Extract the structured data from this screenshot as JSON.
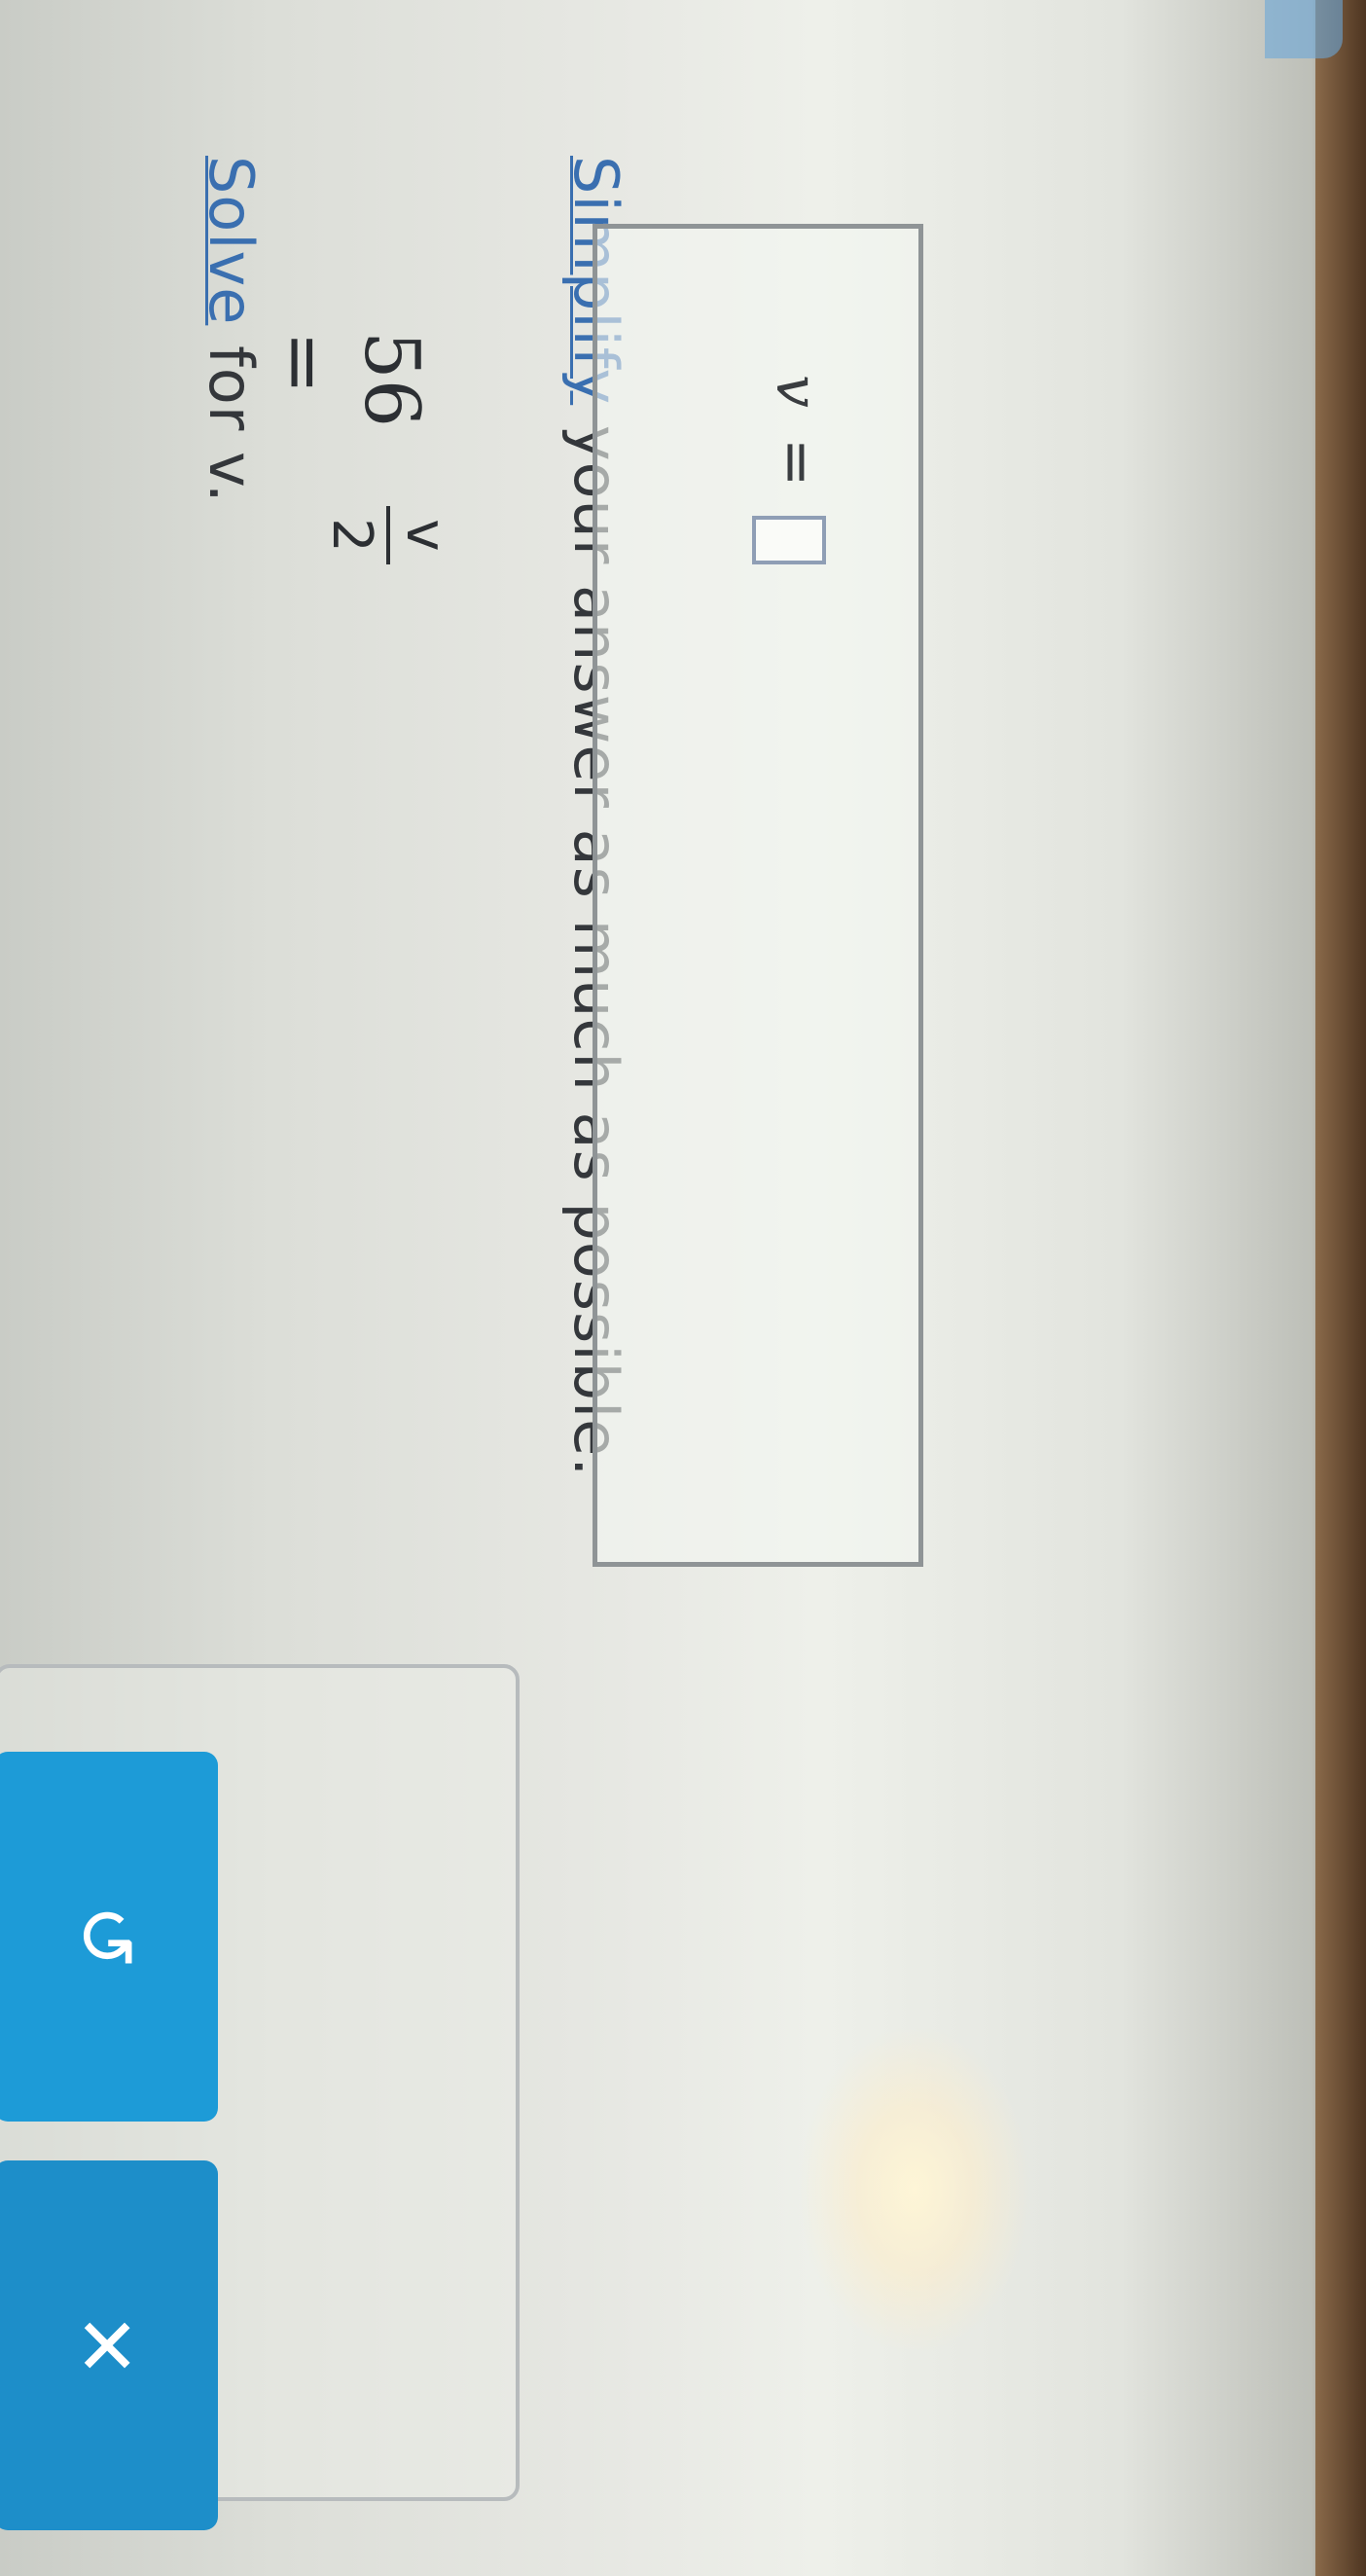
{
  "problem": {
    "instruction_prefix": "Solve for ",
    "instruction_var": "v.",
    "solve_link": "Solve",
    "equation": {
      "lhs": "56 =",
      "numerator": "v",
      "denominator": "2"
    },
    "simplify_link": "Simplify",
    "simplify_rest": " your answer as much as possible."
  },
  "answer": {
    "variable": "v",
    "equals": "=",
    "value": ""
  },
  "toolbar": {
    "fraction_tool": "fraction-icon",
    "undo_icon": "↺",
    "clear_icon": "✕"
  },
  "colors": {
    "button": "#1d9bd7",
    "link": "#3a6fb0"
  }
}
